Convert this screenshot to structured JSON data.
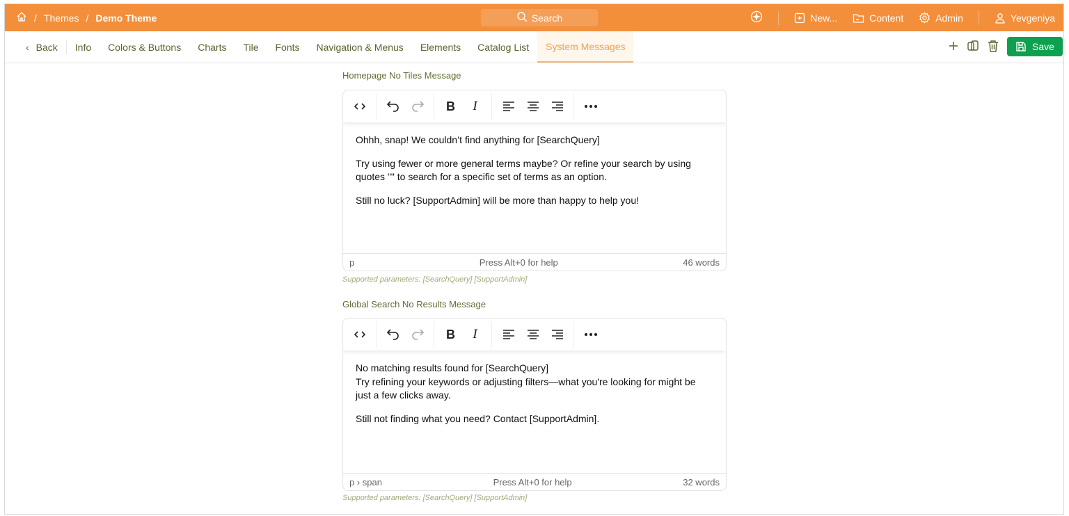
{
  "topbar": {
    "breadcrumbs": [
      "Themes",
      "Demo Theme"
    ],
    "search_label": "Search",
    "new_label": "New...",
    "content_label": "Content",
    "admin_label": "Admin",
    "user_label": "Yevgeniya"
  },
  "nav": {
    "back_label": "Back",
    "tabs": [
      "Info",
      "Colors & Buttons",
      "Charts",
      "Tile",
      "Fonts",
      "Navigation & Menus",
      "Elements",
      "Catalog List",
      "System Messages"
    ],
    "active_tab": "System Messages",
    "save_label": "Save"
  },
  "editors": [
    {
      "label": "Homepage No Tiles Message",
      "paragraphs": [
        [
          "Ohhh, snap! We couldn’t find anything for [SearchQuery]"
        ],
        [
          "Try using fewer or more general terms maybe? Or refine your search by using quotes \"\" to search for a specific set of terms as an option."
        ],
        [
          "Still no luck? [SupportAdmin] will be more than happy to help you!"
        ]
      ],
      "path": "p",
      "help": "Press Alt+0 for help",
      "words": "46 words",
      "hint": "Supported parameters: [SearchQuery] [SupportAdmin]"
    },
    {
      "label": "Global Search No Results Message",
      "paragraphs": [
        [
          "No matching results found for [SearchQuery]",
          "Try refining your keywords or adjusting filters—what you're looking for might be just a few clicks away."
        ],
        [
          "Still not finding what you need? Contact [SupportAdmin]."
        ]
      ],
      "path": "p › span",
      "help": "Press Alt+0 for help",
      "words": "32 words",
      "hint": "Supported parameters: [SearchQuery] [SupportAdmin]"
    }
  ],
  "colors": {
    "brand": "#f38f3b",
    "save": "#0fa04f",
    "nav_text": "#55662e"
  }
}
